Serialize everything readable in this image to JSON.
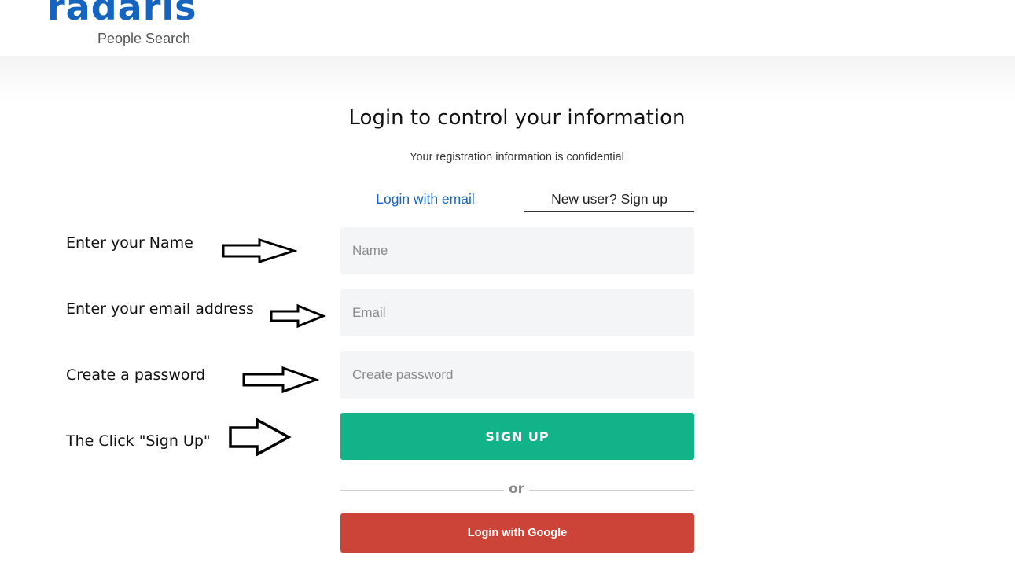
{
  "header": {
    "logo_text": "radaris",
    "logo_subtitle": "People Search"
  },
  "main": {
    "title": "Login to control your information",
    "subtitle": "Your registration information is confidential",
    "tabs": [
      {
        "label": "Login with email",
        "active": false
      },
      {
        "label": "New user? Sign up",
        "active": true
      }
    ],
    "fields": {
      "name": {
        "placeholder": "Name",
        "value": ""
      },
      "email": {
        "placeholder": "Email",
        "value": ""
      },
      "password": {
        "placeholder": "Create password",
        "value": ""
      }
    },
    "signup_label": "SIGN UP",
    "or_text": "or",
    "google_label": "Login with Google"
  },
  "annotations": [
    {
      "text": "Enter your Name",
      "icon": "right-arrow-icon"
    },
    {
      "text": "Enter your email address",
      "icon": "right-arrow-icon"
    },
    {
      "text": "Create a password",
      "icon": "right-arrow-icon"
    },
    {
      "text": "The Click \"Sign Up\"",
      "icon": "right-arrow-icon"
    }
  ],
  "colors": {
    "brand_blue": "#1565c0",
    "signup_green": "#12b388",
    "google_red": "#cc4338",
    "field_bg": "#f4f5f7"
  }
}
